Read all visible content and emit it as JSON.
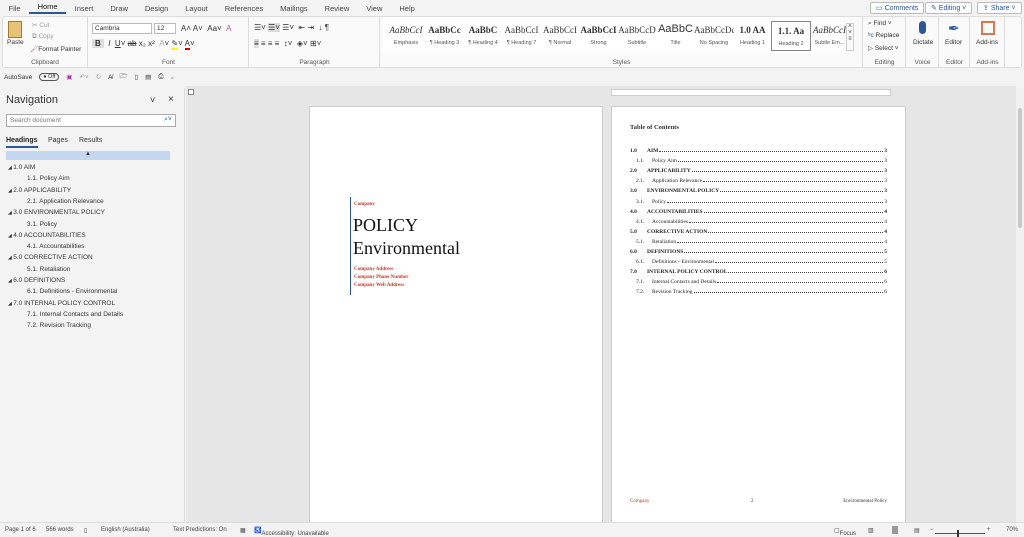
{
  "tabs": [
    "File",
    "Home",
    "Insert",
    "Draw",
    "Design",
    "Layout",
    "References",
    "Mailings",
    "Review",
    "View",
    "Help"
  ],
  "top_buttons": {
    "comments": "Comments",
    "editing": "Editing",
    "share": "Share"
  },
  "clipboard": {
    "paste": "Paste",
    "cut": "Cut",
    "copy": "Copy",
    "format_painter": "Format Painter",
    "label": "Clipboard"
  },
  "font": {
    "name": "Cambria",
    "size": "12",
    "label": "Font"
  },
  "paragraph": {
    "label": "Paragraph"
  },
  "styles": {
    "label": "Styles",
    "items": [
      {
        "sample": "AaBbCcI",
        "name": "Emphasis"
      },
      {
        "sample": "AaBbCc",
        "name": "¶ Heading 3"
      },
      {
        "sample": "AaBbC",
        "name": "¶ Heading 4"
      },
      {
        "sample": "AaBbCcI",
        "name": "¶ Heading 7"
      },
      {
        "sample": "AaBbCcI",
        "name": "¶ Normal"
      },
      {
        "sample": "AaBbCcI",
        "name": "Strong"
      },
      {
        "sample": "AaBbCcD",
        "name": "Subtitle"
      },
      {
        "sample": "AaBbC",
        "name": "Title"
      },
      {
        "sample": "AaBbCcDc",
        "name": "No Spacing"
      },
      {
        "sample": "1.0 AA",
        "name": "Heading 1"
      },
      {
        "sample": "1.1. Aa",
        "name": "Heading 2"
      },
      {
        "sample": "AaBbCcI",
        "name": "Subtle Em..."
      }
    ]
  },
  "editing": {
    "find": "Find",
    "replace": "Replace",
    "select": "Select",
    "label": "Editing"
  },
  "voice": {
    "dictate": "Dictate",
    "label": "Voice"
  },
  "editor": {
    "button": "Editor",
    "label": "Editor"
  },
  "addins": {
    "button": "Add-ins",
    "label": "Add-ins"
  },
  "quick_access": {
    "autosave": "AutoSave",
    "toggle": "Off"
  },
  "navigation": {
    "title": "Navigation",
    "search_placeholder": "Search document",
    "tabs": [
      "Headings",
      "Pages",
      "Results"
    ],
    "items": [
      {
        "text": "1.0 AIM",
        "level": 1
      },
      {
        "text": "1.1. Policy Aim",
        "level": 2
      },
      {
        "text": "2.0 APPLICABILITY",
        "level": 1
      },
      {
        "text": "2.1. Application Relevance",
        "level": 2
      },
      {
        "text": "3.0 ENVIRONMENTAL POLICY",
        "level": 1
      },
      {
        "text": "3.1. Policy",
        "level": 2
      },
      {
        "text": "4.0 ACCOUNTABILITIES",
        "level": 1
      },
      {
        "text": "4.1. Accountabilities",
        "level": 2
      },
      {
        "text": "5.0 CORRECTIVE ACTION",
        "level": 1
      },
      {
        "text": "5.1. Retaliation",
        "level": 2
      },
      {
        "text": "6.0 DEFINITIONS",
        "level": 1
      },
      {
        "text": "6.1. Definitions - Environmental",
        "level": 2
      },
      {
        "text": "7.0 INTERNAL POLICY CONTROL",
        "level": 1
      },
      {
        "text": "7.1. Internal Contacts and Details",
        "level": 2
      },
      {
        "text": "7.2. Revision Tracking",
        "level": 2
      }
    ]
  },
  "cover": {
    "company": "Company",
    "title1": "POLICY",
    "title2": "Environmental",
    "address": "Company Address",
    "phone": "Company Phone Number",
    "web": "Company Web Address"
  },
  "toc": {
    "title": "Table of Contents",
    "entries": [
      {
        "num": "1.0",
        "text": "AIM",
        "page": "3",
        "h": true
      },
      {
        "num": "1.1.",
        "text": "Policy Aim",
        "page": "3"
      },
      {
        "num": "2.0",
        "text": "APPLICABILITY",
        "page": "3",
        "h": true
      },
      {
        "num": "2.1.",
        "text": "Application Relevance",
        "page": "3"
      },
      {
        "num": "3.0",
        "text": "ENVIRONMENTAL POLICY",
        "page": "3",
        "h": true
      },
      {
        "num": "3.1.",
        "text": "Policy",
        "page": "3"
      },
      {
        "num": "4.0",
        "text": "ACCOUNTABILITIES",
        "page": "4",
        "h": true
      },
      {
        "num": "4.1.",
        "text": "Accountabilities",
        "page": "4"
      },
      {
        "num": "5.0",
        "text": "CORRECTIVE ACTION",
        "page": "4",
        "h": true
      },
      {
        "num": "5.1.",
        "text": "Retaliation",
        "page": "4"
      },
      {
        "num": "6.0",
        "text": "DEFINITIONS",
        "page": "5",
        "h": true
      },
      {
        "num": "6.1.",
        "text": "Definitions - Environmental",
        "page": "5"
      },
      {
        "num": "7.0",
        "text": "INTERNAL POLICY CONTROL",
        "page": "6",
        "h": true
      },
      {
        "num": "7.1.",
        "text": "Internal Contacts and Details",
        "page": "6"
      },
      {
        "num": "7.2.",
        "text": "Revision Tracking",
        "page": "6"
      }
    ]
  },
  "footer": {
    "company": "Company",
    "page": "2",
    "doc": "Environmental Policy"
  },
  "status": {
    "page": "Page 1 of 6",
    "words": "566 words",
    "language": "English (Australia)",
    "predictions": "Text Predictions: On",
    "accessibility": "Accessibility: Unavailable",
    "focus": "Focus",
    "zoom": "70%"
  },
  "colors": {
    "accent": "#2b579a",
    "company_red": "#c0392b",
    "cover_rule": "#2b579a"
  }
}
